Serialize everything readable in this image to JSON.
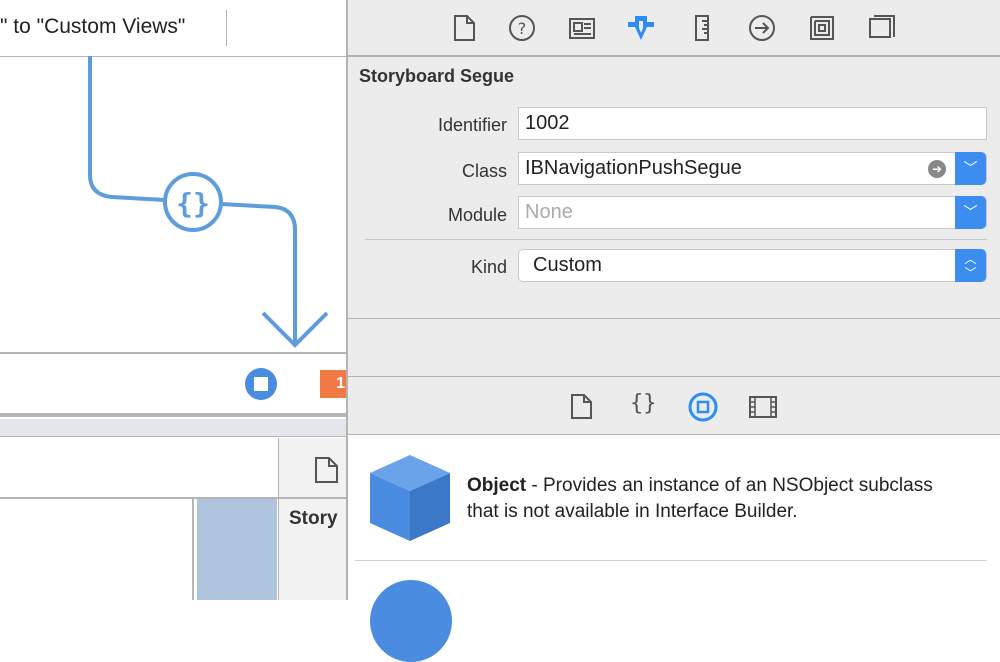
{
  "canvas": {
    "segue_title": "\" to \"Custom Views\"",
    "outline_header": "Story",
    "badge_count": "1"
  },
  "inspector": {
    "section_title": "Storyboard Segue",
    "identifier_label": "Identifier",
    "identifier_value": "1002",
    "class_label": "Class",
    "class_value": "IBNavigationPushSegue",
    "module_label": "Module",
    "module_placeholder": "None",
    "kind_label": "Kind",
    "kind_value": "Custom"
  },
  "library": {
    "items": [
      {
        "title": "Object",
        "description": " - Provides an instance of an NSObject subclass that is not available in Interface Builder."
      }
    ]
  },
  "colors": {
    "accent": "#3b8ef0",
    "segue": "#5d9ddb",
    "object_cube": "#4a8ce0"
  }
}
